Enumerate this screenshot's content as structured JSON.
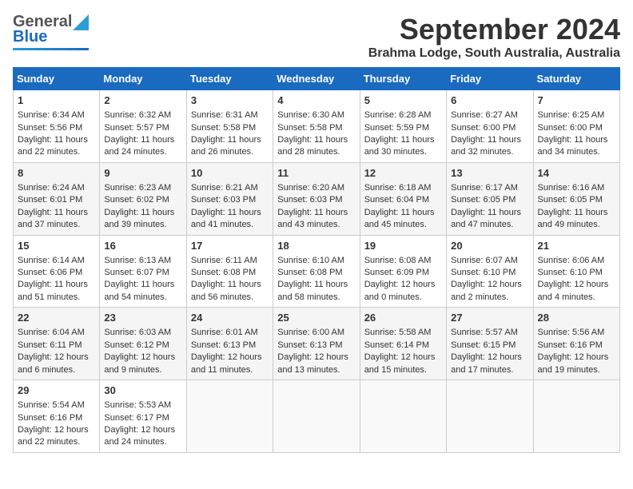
{
  "header": {
    "month_title": "September 2024",
    "location": "Brahma Lodge, South Australia, Australia",
    "logo_general": "General",
    "logo_blue": "Blue"
  },
  "days_of_week": [
    "Sunday",
    "Monday",
    "Tuesday",
    "Wednesday",
    "Thursday",
    "Friday",
    "Saturday"
  ],
  "weeks": [
    [
      {
        "day": "1",
        "sunrise": "Sunrise: 6:34 AM",
        "sunset": "Sunset: 5:56 PM",
        "daylight": "Daylight: 11 hours and 22 minutes."
      },
      {
        "day": "2",
        "sunrise": "Sunrise: 6:32 AM",
        "sunset": "Sunset: 5:57 PM",
        "daylight": "Daylight: 11 hours and 24 minutes."
      },
      {
        "day": "3",
        "sunrise": "Sunrise: 6:31 AM",
        "sunset": "Sunset: 5:58 PM",
        "daylight": "Daylight: 11 hours and 26 minutes."
      },
      {
        "day": "4",
        "sunrise": "Sunrise: 6:30 AM",
        "sunset": "Sunset: 5:58 PM",
        "daylight": "Daylight: 11 hours and 28 minutes."
      },
      {
        "day": "5",
        "sunrise": "Sunrise: 6:28 AM",
        "sunset": "Sunset: 5:59 PM",
        "daylight": "Daylight: 11 hours and 30 minutes."
      },
      {
        "day": "6",
        "sunrise": "Sunrise: 6:27 AM",
        "sunset": "Sunset: 6:00 PM",
        "daylight": "Daylight: 11 hours and 32 minutes."
      },
      {
        "day": "7",
        "sunrise": "Sunrise: 6:25 AM",
        "sunset": "Sunset: 6:00 PM",
        "daylight": "Daylight: 11 hours and 34 minutes."
      }
    ],
    [
      {
        "day": "8",
        "sunrise": "Sunrise: 6:24 AM",
        "sunset": "Sunset: 6:01 PM",
        "daylight": "Daylight: 11 hours and 37 minutes."
      },
      {
        "day": "9",
        "sunrise": "Sunrise: 6:23 AM",
        "sunset": "Sunset: 6:02 PM",
        "daylight": "Daylight: 11 hours and 39 minutes."
      },
      {
        "day": "10",
        "sunrise": "Sunrise: 6:21 AM",
        "sunset": "Sunset: 6:03 PM",
        "daylight": "Daylight: 11 hours and 41 minutes."
      },
      {
        "day": "11",
        "sunrise": "Sunrise: 6:20 AM",
        "sunset": "Sunset: 6:03 PM",
        "daylight": "Daylight: 11 hours and 43 minutes."
      },
      {
        "day": "12",
        "sunrise": "Sunrise: 6:18 AM",
        "sunset": "Sunset: 6:04 PM",
        "daylight": "Daylight: 11 hours and 45 minutes."
      },
      {
        "day": "13",
        "sunrise": "Sunrise: 6:17 AM",
        "sunset": "Sunset: 6:05 PM",
        "daylight": "Daylight: 11 hours and 47 minutes."
      },
      {
        "day": "14",
        "sunrise": "Sunrise: 6:16 AM",
        "sunset": "Sunset: 6:05 PM",
        "daylight": "Daylight: 11 hours and 49 minutes."
      }
    ],
    [
      {
        "day": "15",
        "sunrise": "Sunrise: 6:14 AM",
        "sunset": "Sunset: 6:06 PM",
        "daylight": "Daylight: 11 hours and 51 minutes."
      },
      {
        "day": "16",
        "sunrise": "Sunrise: 6:13 AM",
        "sunset": "Sunset: 6:07 PM",
        "daylight": "Daylight: 11 hours and 54 minutes."
      },
      {
        "day": "17",
        "sunrise": "Sunrise: 6:11 AM",
        "sunset": "Sunset: 6:08 PM",
        "daylight": "Daylight: 11 hours and 56 minutes."
      },
      {
        "day": "18",
        "sunrise": "Sunrise: 6:10 AM",
        "sunset": "Sunset: 6:08 PM",
        "daylight": "Daylight: 11 hours and 58 minutes."
      },
      {
        "day": "19",
        "sunrise": "Sunrise: 6:08 AM",
        "sunset": "Sunset: 6:09 PM",
        "daylight": "Daylight: 12 hours and 0 minutes."
      },
      {
        "day": "20",
        "sunrise": "Sunrise: 6:07 AM",
        "sunset": "Sunset: 6:10 PM",
        "daylight": "Daylight: 12 hours and 2 minutes."
      },
      {
        "day": "21",
        "sunrise": "Sunrise: 6:06 AM",
        "sunset": "Sunset: 6:10 PM",
        "daylight": "Daylight: 12 hours and 4 minutes."
      }
    ],
    [
      {
        "day": "22",
        "sunrise": "Sunrise: 6:04 AM",
        "sunset": "Sunset: 6:11 PM",
        "daylight": "Daylight: 12 hours and 6 minutes."
      },
      {
        "day": "23",
        "sunrise": "Sunrise: 6:03 AM",
        "sunset": "Sunset: 6:12 PM",
        "daylight": "Daylight: 12 hours and 9 minutes."
      },
      {
        "day": "24",
        "sunrise": "Sunrise: 6:01 AM",
        "sunset": "Sunset: 6:13 PM",
        "daylight": "Daylight: 12 hours and 11 minutes."
      },
      {
        "day": "25",
        "sunrise": "Sunrise: 6:00 AM",
        "sunset": "Sunset: 6:13 PM",
        "daylight": "Daylight: 12 hours and 13 minutes."
      },
      {
        "day": "26",
        "sunrise": "Sunrise: 5:58 AM",
        "sunset": "Sunset: 6:14 PM",
        "daylight": "Daylight: 12 hours and 15 minutes."
      },
      {
        "day": "27",
        "sunrise": "Sunrise: 5:57 AM",
        "sunset": "Sunset: 6:15 PM",
        "daylight": "Daylight: 12 hours and 17 minutes."
      },
      {
        "day": "28",
        "sunrise": "Sunrise: 5:56 AM",
        "sunset": "Sunset: 6:16 PM",
        "daylight": "Daylight: 12 hours and 19 minutes."
      }
    ],
    [
      {
        "day": "29",
        "sunrise": "Sunrise: 5:54 AM",
        "sunset": "Sunset: 6:16 PM",
        "daylight": "Daylight: 12 hours and 22 minutes."
      },
      {
        "day": "30",
        "sunrise": "Sunrise: 5:53 AM",
        "sunset": "Sunset: 6:17 PM",
        "daylight": "Daylight: 12 hours and 24 minutes."
      },
      null,
      null,
      null,
      null,
      null
    ]
  ]
}
